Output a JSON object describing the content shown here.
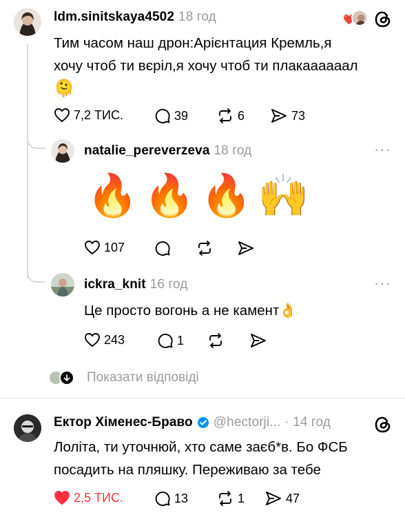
{
  "post1": {
    "username": "ldm.sinitskaya4502",
    "time": "18 год",
    "text_line1": "Тим часом наш дрон:Арієнтация Кремль,я",
    "text_line2": "хочу чтоб ти вєріл,я хочу чтоб ти плакаааааал",
    "emoji": "🫠",
    "likes": "7,2 ТИС.",
    "comments": "39",
    "reposts": "6",
    "shares": "73",
    "liked_by_emoji": "❤️"
  },
  "reply1": {
    "username": "natalie_pereverzeva",
    "time": "18 год",
    "emojis": "🔥🔥🔥🙌",
    "likes": "107"
  },
  "reply2": {
    "username": "ickra_knit",
    "time": "16 год",
    "text": "Це просто вогонь а не камент👌",
    "likes": "243",
    "comments": "1"
  },
  "show_replies": {
    "label": "Показати відповіді"
  },
  "post2": {
    "username": "Ектор Хіменес-Браво",
    "handle": "@hectorji...",
    "time": "· 14 год",
    "text_line1": "Лоліта, ти уточнюй, хто саме заєб*в. Бо ФСБ",
    "text_line2": "посадить на пляшку. Переживаю за тебе",
    "likes": "2,5 ТИС.",
    "comments": "13",
    "reposts": "1",
    "shares": "47"
  },
  "colors": {
    "liked_red": "#ff3040",
    "verified_blue": "#0095f6",
    "muted_gray": "#9a9a9a"
  }
}
